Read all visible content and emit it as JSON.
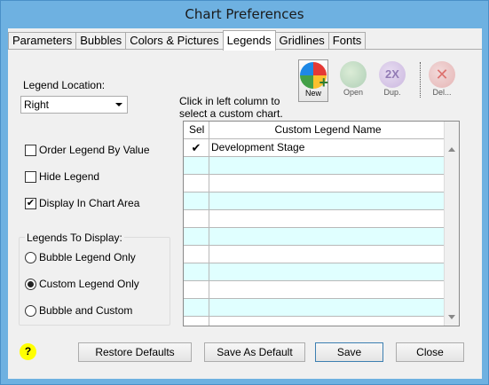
{
  "window": {
    "title": "Chart Preferences"
  },
  "tabs": [
    "Parameters",
    "Bubbles",
    "Colors & Pictures",
    "Legends",
    "Gridlines",
    "Fonts"
  ],
  "active_tab": "Legends",
  "legend_location": {
    "label": "Legend Location:",
    "value": "Right"
  },
  "options": {
    "order_by_value": {
      "label": "Order Legend By Value",
      "checked": false
    },
    "hide_legend": {
      "label": "Hide Legend",
      "checked": false
    },
    "display_in_chart": {
      "label": "Display In Chart Area",
      "checked": true
    }
  },
  "legends_to_display": {
    "title": "Legends To Display:",
    "items": [
      {
        "label": "Bubble Legend Only",
        "selected": false
      },
      {
        "label": "Custom Legend Only",
        "selected": true
      },
      {
        "label": "Bubble and Custom",
        "selected": false
      }
    ]
  },
  "toolbar": {
    "new": "New",
    "open": "Open",
    "dup": "Dup.",
    "delete": "Del..."
  },
  "instruction": {
    "line1": "Click in left column to",
    "line2": "select a custom chart."
  },
  "custom_grid": {
    "headers": [
      "Sel",
      "Custom Legend Name"
    ],
    "rows": [
      {
        "sel": "✔",
        "name": "Development Stage"
      }
    ]
  },
  "buttons": {
    "restore": "Restore Defaults",
    "save_default": "Save As Default",
    "save": "Save",
    "close": "Close"
  },
  "help_glyph": "?",
  "colors": {
    "row_alt": "#e0ffff",
    "accent": "#3c7fb1"
  }
}
